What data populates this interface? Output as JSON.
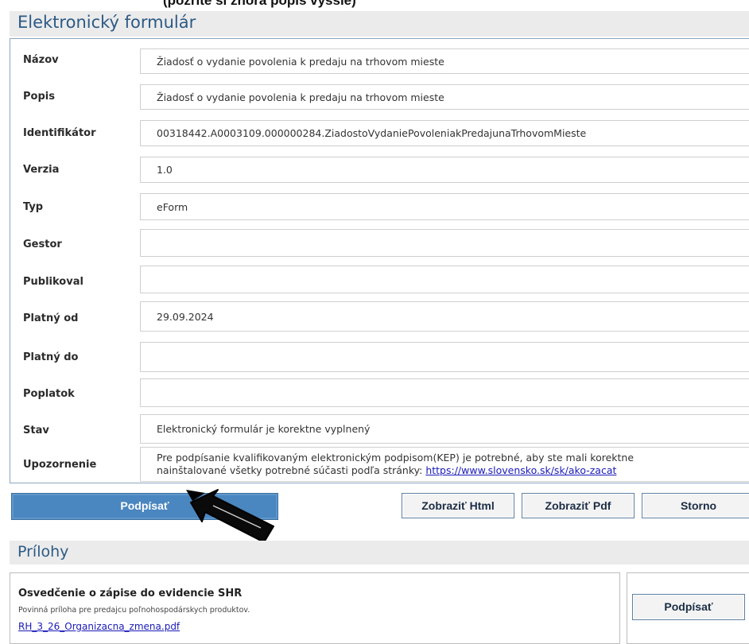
{
  "top_cut_text": "(pozrite si zhora popis vyššie)",
  "form": {
    "header": "Elektronický formulár",
    "rows": [
      {
        "label": "Názov",
        "value": "Žiadosť o vydanie povolenia k predaju na trhovom mieste"
      },
      {
        "label": "Popis",
        "value": "Žiadosť o vydanie povolenia k predaju na trhovom mieste"
      },
      {
        "label": "Identifikátor",
        "value": "00318442.A0003109.000000284.ZiadostoVydaniePovoleniakPredajunaTrhovomMieste"
      },
      {
        "label": "Verzia",
        "value": "1.0"
      },
      {
        "label": "Typ",
        "value": "eForm"
      },
      {
        "label": "Gestor",
        "value": ""
      },
      {
        "label": "Publikoval",
        "value": ""
      },
      {
        "label": "Platný od",
        "value": "29.09.2024"
      },
      {
        "label": "Platný do",
        "value": ""
      },
      {
        "label": "Poplatok",
        "value": ""
      },
      {
        "label": "Stav",
        "value": "Elektronický formulár je korektne vyplnený"
      }
    ],
    "notice": {
      "label": "Upozornenie",
      "line1": "Pre podpísanie kvalifikovaným elektronickým podpisom(KEP) je potrebné, aby ste mali korektne",
      "line2_prefix": "nainštalované všetky potrebné súčasti podľa stránky: ",
      "link": "https://www.slovensko.sk/sk/ako-zacat"
    }
  },
  "buttons": {
    "sign": "Podpísať",
    "show_html": "Zobraziť Html",
    "show_pdf": "Zobraziť Pdf",
    "cancel": "Storno"
  },
  "attachments": {
    "header": "Prílohy",
    "items": [
      {
        "title": "Osvedčenie o zápise do evidencie SHR",
        "description": "Povinná príloha pre predajcu poľnohospodárskych produktov.",
        "file": "RH_3_26_Organizacna_zmena.pdf",
        "sign_label": "Podpísať"
      }
    ]
  },
  "colors": {
    "header_text": "#2c5a85",
    "header_bg": "#ebebeb",
    "primary_button": "#4a86bf",
    "link": "#1a1ab8",
    "panel_border": "#8aa6c1"
  }
}
